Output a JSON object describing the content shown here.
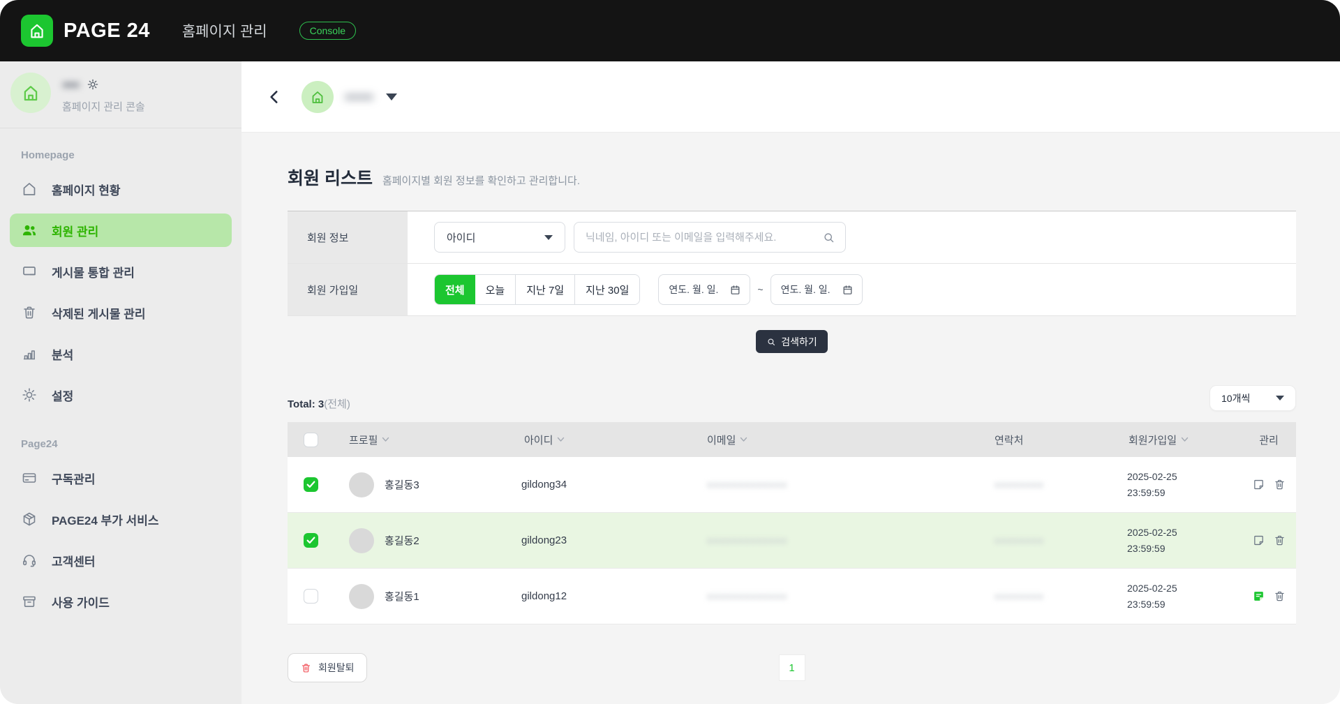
{
  "topbar": {
    "brand": "PAGE 24",
    "title": "홈페이지 관리",
    "badge": "Console"
  },
  "sidebar": {
    "profile": {
      "name_masked": "●●●",
      "subtitle": "홈페이지 관리 콘솔"
    },
    "sections": [
      {
        "label": "Homepage",
        "items": [
          {
            "label": "홈페이지 현황"
          },
          {
            "label": "회원 관리"
          },
          {
            "label": "게시물 통합 관리"
          },
          {
            "label": "삭제된 게시물 관리"
          },
          {
            "label": "분석"
          },
          {
            "label": "설정"
          }
        ]
      },
      {
        "label": "Page24",
        "items": [
          {
            "label": "구독관리"
          },
          {
            "label": "PAGE24 부가 서비스"
          },
          {
            "label": "고객센터"
          },
          {
            "label": "사용 가이드"
          }
        ]
      }
    ]
  },
  "header": {
    "site_name_masked": "●●●●"
  },
  "page": {
    "title": "회원 리스트",
    "description": "홈페이지별 회원 정보를 확인하고 관리합니다."
  },
  "filters": {
    "row1_label": "회원 정보",
    "search_type": "아이디",
    "search_placeholder": "닉네임, 아이디 또는 이메일을 입력해주세요.",
    "row2_label": "회원 가입일",
    "period_options": [
      "전체",
      "오늘",
      "지난 7일",
      "지난 30일"
    ],
    "period_selected": "전체",
    "date_placeholder_from": "연도. 월. 일.",
    "date_separator": "~",
    "date_placeholder_to": "연도. 월. 일.",
    "search_button": "검색하기"
  },
  "list": {
    "total_label": "Total: 3",
    "total_suffix": "(전체)",
    "page_size": "10개씩",
    "columns": [
      {
        "label": "프로필"
      },
      {
        "label": "아이디"
      },
      {
        "label": "이메일"
      },
      {
        "label": "연락처"
      },
      {
        "label": "회원가입일"
      },
      {
        "label": "관리"
      }
    ],
    "rows": [
      {
        "checked": true,
        "name": "홍길동3",
        "user_id": "gildong34",
        "email_masked": "●●●●●●●●●●●●●",
        "phone_masked": "●●●●●●●●",
        "joined_date": "2025-02-25",
        "joined_time": "23:59:59"
      },
      {
        "checked": true,
        "name": "홍길동2",
        "user_id": "gildong23",
        "email_masked": "●●●●●●●●●●●●●",
        "phone_masked": "●●●●●●●●",
        "joined_date": "2025-02-25",
        "joined_time": "23:59:59"
      },
      {
        "checked": false,
        "name": "홍길동1",
        "user_id": "gildong12",
        "email_masked": "●●●●●●●●●●●●●",
        "phone_masked": "●●●●●●●●",
        "joined_date": "2025-02-25",
        "joined_time": "23:59:59"
      }
    ],
    "delete_button": "회원탈퇴",
    "pagination_current": "1"
  },
  "colors": {
    "primary_green": "#1CC630",
    "active_item_bg": "#B7E7A9",
    "active_item_text": "#2DB400",
    "row_highlight": "#E9F6E2",
    "dark_button": "#2B3240",
    "danger_red": "#F2545B",
    "topbar_bg": "#141414",
    "sidebar_bg": "#ECECEC"
  }
}
